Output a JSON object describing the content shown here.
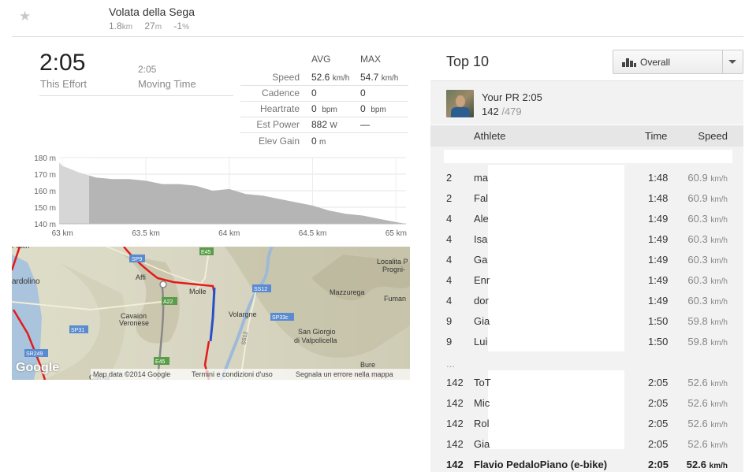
{
  "segment": {
    "title": "Volata della Sega",
    "distance": "1.8",
    "distance_unit": "km",
    "elev_diff": "27",
    "elev_unit": "m",
    "grade": "-1",
    "grade_unit": "%"
  },
  "effort": {
    "time": "2:05",
    "time_label": "This Effort",
    "moving_time": "2:05",
    "moving_label": "Moving Time"
  },
  "stats": {
    "avg_header": "AVG",
    "max_header": "MAX",
    "rows": [
      {
        "label": "Speed",
        "avg": "52.6",
        "avg_unit": "km/h",
        "max": "54.7",
        "max_unit": "km/h"
      },
      {
        "label": "Cadence",
        "avg": "0",
        "avg_unit": "",
        "max": "0",
        "max_unit": ""
      },
      {
        "label": "Heartrate",
        "avg": "0",
        "avg_unit": "bpm",
        "max": "0",
        "max_unit": "bpm"
      },
      {
        "label": "Est Power",
        "avg": "882",
        "avg_unit": "W",
        "max": "—",
        "max_unit": ""
      },
      {
        "label": "Elev Gain",
        "avg": "0",
        "avg_unit": "m",
        "max": "",
        "max_unit": ""
      }
    ]
  },
  "chart_data": {
    "type": "area",
    "xlabel": "",
    "ylabel": "",
    "x_ticks": [
      "63 km",
      "63.5 km",
      "64 km",
      "64.5 km",
      "65 km"
    ],
    "y_ticks": [
      "180 m",
      "170 m",
      "160 m",
      "150 m",
      "140 m"
    ],
    "xlim": [
      62.98,
      65.06
    ],
    "ylim": [
      140,
      180
    ],
    "x": [
      62.98,
      63.0,
      63.1,
      63.2,
      63.3,
      63.4,
      63.5,
      63.6,
      63.7,
      63.8,
      63.9,
      64.0,
      64.1,
      64.2,
      64.3,
      64.4,
      64.5,
      64.6,
      64.7,
      64.8,
      64.9,
      65.0,
      65.06
    ],
    "y": [
      177,
      175,
      171,
      168,
      167,
      167,
      166,
      164,
      164,
      163,
      160,
      161,
      158,
      157,
      155,
      153,
      151,
      148,
      146,
      145,
      143,
      141,
      140
    ],
    "highlight_range": [
      62.98,
      63.16
    ]
  },
  "map": {
    "attribution": "Map data ©2014 Google",
    "terms": "Termini e condizioni d'uso",
    "report": "Segnala un errore nella mappa",
    "logo": "Google",
    "places": [
      "Affi",
      "Molle",
      "Cavaion Veronese",
      "Volargne",
      "Mazzurega",
      "San Giorgio di Valpolicella",
      "Localita P",
      "Progni-",
      "Fuman",
      "Bure",
      "Calma",
      "ardolino",
      "Pesch"
    ],
    "road_labels": [
      "SP9",
      "E45",
      "A22",
      "SS12",
      "SP33c",
      "SP31",
      "E45",
      "SR249",
      "SS12"
    ]
  },
  "top10": {
    "title": "Top 10",
    "filter": "Overall",
    "pr_label": "Your PR 2:05",
    "pr_rank": "142",
    "pr_total": "/479",
    "headers": {
      "athlete": "Athlete",
      "time": "Time",
      "speed": "Speed"
    },
    "rows": [
      {
        "rank": "2",
        "name": "ma",
        "time": "1:48",
        "speed": "60.9",
        "unit": "km/h"
      },
      {
        "rank": "2",
        "name": "Fal",
        "time": "1:48",
        "speed": "60.9",
        "unit": "km/h"
      },
      {
        "rank": "4",
        "name": "Ale",
        "time": "1:49",
        "speed": "60.3",
        "unit": "km/h"
      },
      {
        "rank": "4",
        "name": "Isa",
        "time": "1:49",
        "speed": "60.3",
        "unit": "km/h"
      },
      {
        "rank": "4",
        "name": "Ga",
        "time": "1:49",
        "speed": "60.3",
        "unit": "km/h"
      },
      {
        "rank": "4",
        "name": "Enr",
        "time": "1:49",
        "speed": "60.3",
        "unit": "km/h"
      },
      {
        "rank": "4",
        "name": "dor",
        "time": "1:49",
        "speed": "60.3",
        "unit": "km/h"
      },
      {
        "rank": "9",
        "name": "Gia",
        "time": "1:50",
        "speed": "59.8",
        "unit": "km/h"
      },
      {
        "rank": "9",
        "name": "Lui",
        "time": "1:50",
        "speed": "59.8",
        "unit": "km/h"
      }
    ],
    "ellipsis": "...",
    "rows_bottom": [
      {
        "rank": "142",
        "name": "ToT",
        "time": "2:05",
        "speed": "52.6",
        "unit": "km/h"
      },
      {
        "rank": "142",
        "name": "Mic",
        "time": "2:05",
        "speed": "52.6",
        "unit": "km/h"
      },
      {
        "rank": "142",
        "name": "Rol",
        "time": "2:05",
        "speed": "52.6",
        "unit": "km/h"
      },
      {
        "rank": "142",
        "name": "Gia",
        "time": "2:05",
        "speed": "52.6",
        "unit": "km/h"
      }
    ],
    "my_row": {
      "rank": "142",
      "name": "Flavio PedaloPiano (e-bike)",
      "time": "2:05",
      "speed": "52.6",
      "unit": "km/h"
    }
  }
}
